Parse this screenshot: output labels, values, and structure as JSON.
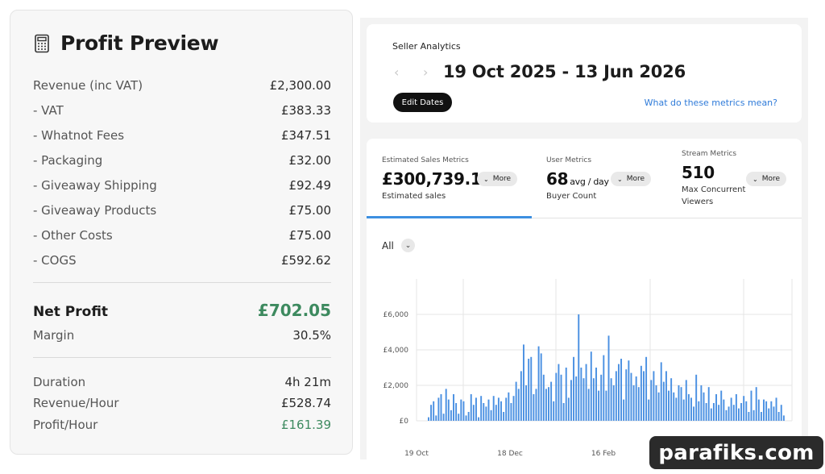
{
  "profit": {
    "title": "Profit Preview",
    "icon": "calculator-icon",
    "rows": [
      {
        "label": "Revenue (inc VAT)",
        "value": "£2,300.00"
      },
      {
        "label": "- VAT",
        "value": "£383.33"
      },
      {
        "label": "- Whatnot Fees",
        "value": "£347.51"
      },
      {
        "label": "- Packaging",
        "value": "£32.00"
      },
      {
        "label": "- Giveaway Shipping",
        "value": "£92.49"
      },
      {
        "label": "- Giveaway Products",
        "value": "£75.00"
      },
      {
        "label": "- Other Costs",
        "value": "£75.00"
      },
      {
        "label": "- COGS",
        "value": "£592.62"
      }
    ],
    "net_profit": {
      "label": "Net Profit",
      "value": "£702.05"
    },
    "margin": {
      "label": "Margin",
      "value": "30.5%"
    },
    "stats": [
      {
        "label": "Duration",
        "value": "4h 21m"
      },
      {
        "label": "Revenue/Hour",
        "value": "£528.74"
      },
      {
        "label": "Profit/Hour",
        "value": "£161.39"
      }
    ],
    "colors": {
      "positive": "#3d8a5f"
    }
  },
  "analytics": {
    "section_label": "Seller Analytics",
    "nav_prev": "‹",
    "nav_next": "›",
    "date_range": "19 Oct 2025 - 13 Jun 2026",
    "edit_dates_label": "Edit Dates",
    "metrics_link": "What do these metrics mean?",
    "metrics": [
      {
        "label": "Estimated Sales Metrics",
        "value": "£300,739.10",
        "unit": "",
        "sub": "Estimated sales",
        "more": "More",
        "active": true
      },
      {
        "label": "User Metrics",
        "value": "68",
        "unit": "avg / day",
        "sub": "Buyer Count",
        "more": "More",
        "active": false
      },
      {
        "label": "Stream Metrics",
        "value": "510",
        "unit": "",
        "sub": "Max Concurrent",
        "sub2": "Viewers",
        "more": "More",
        "active": false
      }
    ],
    "filter": {
      "label": "All",
      "chevron": "⌄"
    },
    "colors": {
      "accent": "#3d8fe0",
      "bar": "#4a90e2"
    }
  },
  "chart_data": {
    "type": "bar",
    "ylim": [
      0,
      8000
    ],
    "yticks": [
      0,
      2000,
      4000,
      6000
    ],
    "ytick_labels": [
      "£0",
      "£2,000",
      "£4,000",
      "£6,000"
    ],
    "xtick_labels": [
      "19 Oct",
      "18 Dec",
      "16 Feb"
    ],
    "grid": true,
    "values": [
      200,
      900,
      1100,
      300,
      1300,
      1500,
      400,
      1800,
      1200,
      600,
      1500,
      1000,
      400,
      1200,
      1100,
      300,
      500,
      1500,
      900,
      1300,
      200,
      1400,
      1000,
      800,
      1200,
      600,
      1400,
      900,
      1300,
      1100,
      500,
      1300,
      1600,
      1000,
      1400,
      2200,
      1800,
      2800,
      4300,
      2000,
      3500,
      3600,
      1500,
      1800,
      4200,
      3800,
      2600,
      1800,
      1900,
      2200,
      1100,
      2700,
      3200,
      2600,
      1000,
      3000,
      1300,
      2300,
      3600,
      2500,
      6000,
      3000,
      2400,
      3200,
      1800,
      3900,
      2400,
      3000,
      1700,
      2600,
      3700,
      1700,
      4800,
      2400,
      2000,
      2800,
      3200,
      3500,
      1200,
      2900,
      3400,
      2700,
      2000,
      2500,
      1900,
      3100,
      2800,
      3600,
      1200,
      2300,
      2800,
      2000,
      1600,
      3300,
      2200,
      2800,
      1700,
      2400,
      1600,
      1300,
      2000,
      1900,
      1200,
      2300,
      1500,
      1300,
      800,
      2600,
      1100,
      2000,
      1600,
      1000,
      1900,
      700,
      1000,
      1500,
      900,
      1700,
      1200,
      600,
      800,
      1300,
      900,
      1500,
      700,
      1000,
      1400,
      1100,
      500,
      1700,
      600,
      1900,
      1200,
      500,
      1200,
      1100,
      700,
      1100,
      800,
      1300,
      500,
      900,
      300
    ]
  },
  "watermark": "parafiks.com"
}
